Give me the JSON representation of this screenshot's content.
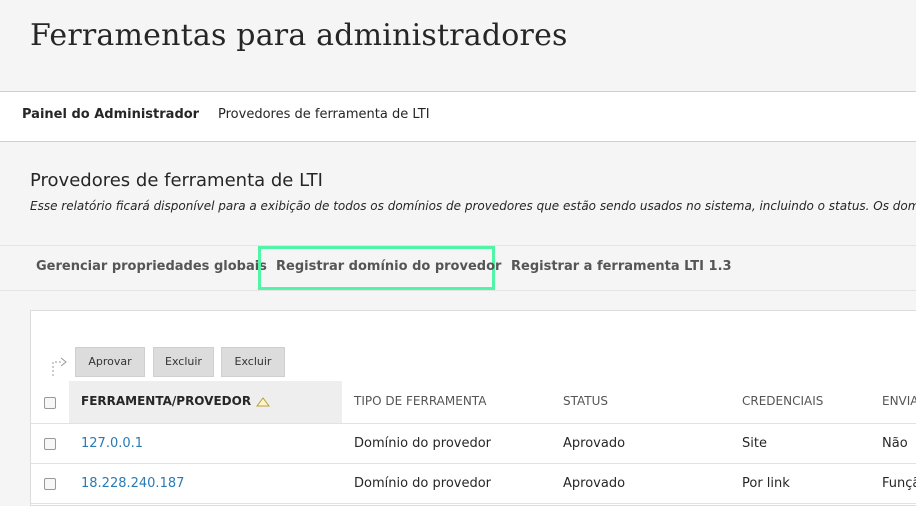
{
  "page": {
    "title": "Ferramentas para administradores"
  },
  "breadcrumb": {
    "items": [
      "Painel do Administrador",
      "Provedores de ferramenta de LTI"
    ]
  },
  "section": {
    "title": "Provedores de ferramenta de LTI",
    "description": "Esse relatório ficará disponível para a exibição de todos os domínios de provedores que estão sendo usados no sistema, incluindo o status. Os domínios pode"
  },
  "actions": {
    "items": [
      "Gerenciar propriedades globais",
      "Registrar domínio do provedor",
      "Registrar a ferramenta LTI 1.3"
    ],
    "highlight_color": "#52f5a5"
  },
  "toolbar": {
    "buttons": [
      "Aprovar",
      "Excluir",
      "Excluir"
    ]
  },
  "table": {
    "columns": [
      "FERRAMENTA/PROVEDOR",
      "TIPO DE FERRAMENTA",
      "STATUS",
      "CREDENCIAIS",
      "ENVIA"
    ],
    "sorted_column": "FERRAMENTA/PROVEDOR",
    "rows": [
      [
        "127.0.0.1",
        "Domínio do provedor",
        "Aprovado",
        "Site",
        "Não"
      ],
      [
        "18.228.240.187",
        "Domínio do provedor",
        "Aprovado",
        "Por link",
        "Funçã"
      ]
    ]
  },
  "colors": {
    "link": "#2a7ab5",
    "background": "#f5f5f5"
  },
  "icons": {
    "sort": "triangle-up-icon",
    "select-all-arrow": "corner-arrow-icon"
  }
}
